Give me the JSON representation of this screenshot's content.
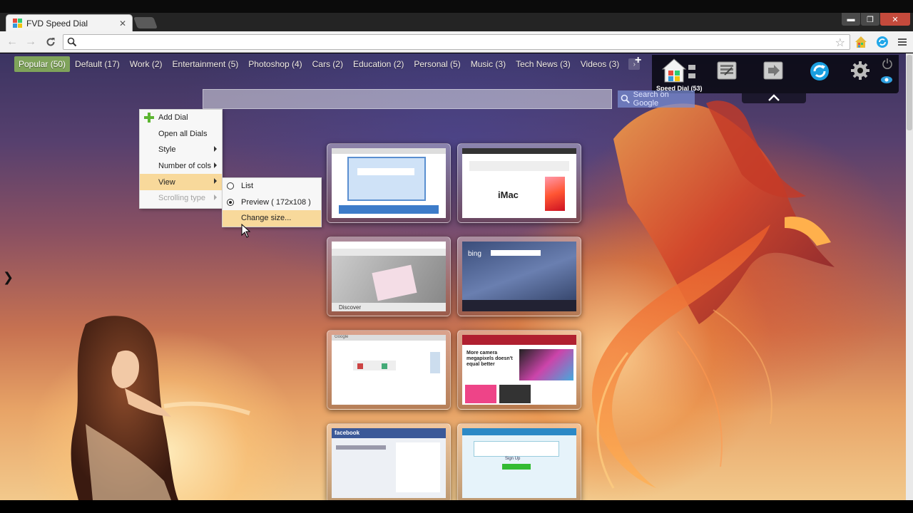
{
  "browser": {
    "tab_title": "FVD Speed Dial",
    "tab_close": "✕",
    "omnibox_placeholder": "",
    "window_controls": {
      "minimize": "▬",
      "maximize": "❐",
      "close": "✕"
    }
  },
  "groups": {
    "items": [
      "Popular (50)",
      "Default (17)",
      "Work (2)",
      "Entertainment (5)",
      "Photoshop (4)",
      "Cars (2)",
      "Education (2)",
      "Personal (5)",
      "Music (3)",
      "Tech News (3)",
      "Videos (3)"
    ],
    "next": "›",
    "add": "+"
  },
  "control_panel": {
    "speed_dial_label": "Speed Dial (53)"
  },
  "search": {
    "placeholder": "",
    "button_label": "Search on Google"
  },
  "dials": [
    {
      "name": "dial-1",
      "label": ""
    },
    {
      "name": "dial-2",
      "label": "iMac"
    },
    {
      "name": "dial-3",
      "label": "Discover"
    },
    {
      "name": "dial-4",
      "label": "bing"
    },
    {
      "name": "dial-5",
      "label": "Google"
    },
    {
      "name": "dial-6",
      "label": "More camera megapixels doesn't equal better"
    },
    {
      "name": "dial-7",
      "label": "facebook"
    },
    {
      "name": "dial-8",
      "label": "Sign Up"
    }
  ],
  "context_menu": {
    "items": [
      {
        "label": "Add Dial",
        "submenu": false,
        "disabled": false
      },
      {
        "label": "Open all Dials",
        "submenu": false,
        "disabled": false
      },
      {
        "label": "Style",
        "submenu": true,
        "disabled": false
      },
      {
        "label": "Number of cols",
        "submenu": true,
        "disabled": false
      },
      {
        "label": "View",
        "submenu": true,
        "disabled": false
      },
      {
        "label": "Scrolling type",
        "submenu": true,
        "disabled": true
      }
    ],
    "view_submenu": [
      {
        "label": "List",
        "checked": false
      },
      {
        "label": "Preview ( 172x108 )",
        "checked": true
      },
      {
        "label": "Change size...",
        "checked": false
      }
    ]
  },
  "side_arrow": "❯",
  "colors": {
    "active_group": "#7fa35a",
    "menu_highlight": "#f8d99b"
  }
}
